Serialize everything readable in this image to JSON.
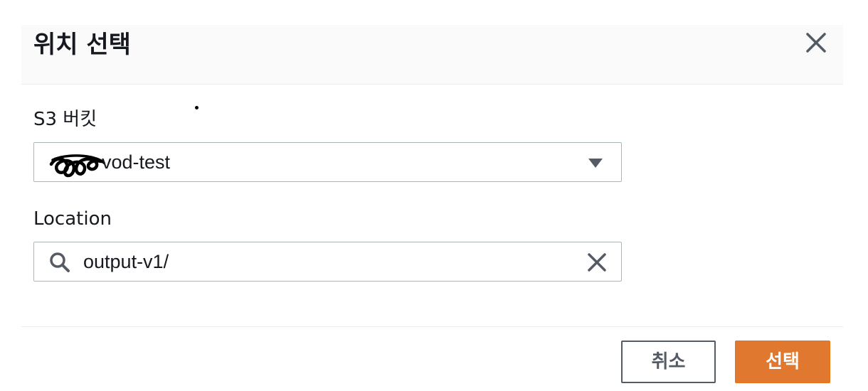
{
  "modal": {
    "title": "위치 선택",
    "close_icon": "close-icon"
  },
  "bucket_field": {
    "label": "S3 버킷",
    "selected_value": "vod-test",
    "caret_icon": "caret-down-icon"
  },
  "location_field": {
    "label": "Location",
    "value": "output-v1/",
    "search_icon": "search-icon",
    "clear_icon": "clear-icon"
  },
  "footer": {
    "cancel_label": "취소",
    "select_label": "선택"
  },
  "colors": {
    "primary": "#e0782f",
    "border": "#aab7b8",
    "text": "#16191f",
    "secondary_text": "#545b64"
  }
}
